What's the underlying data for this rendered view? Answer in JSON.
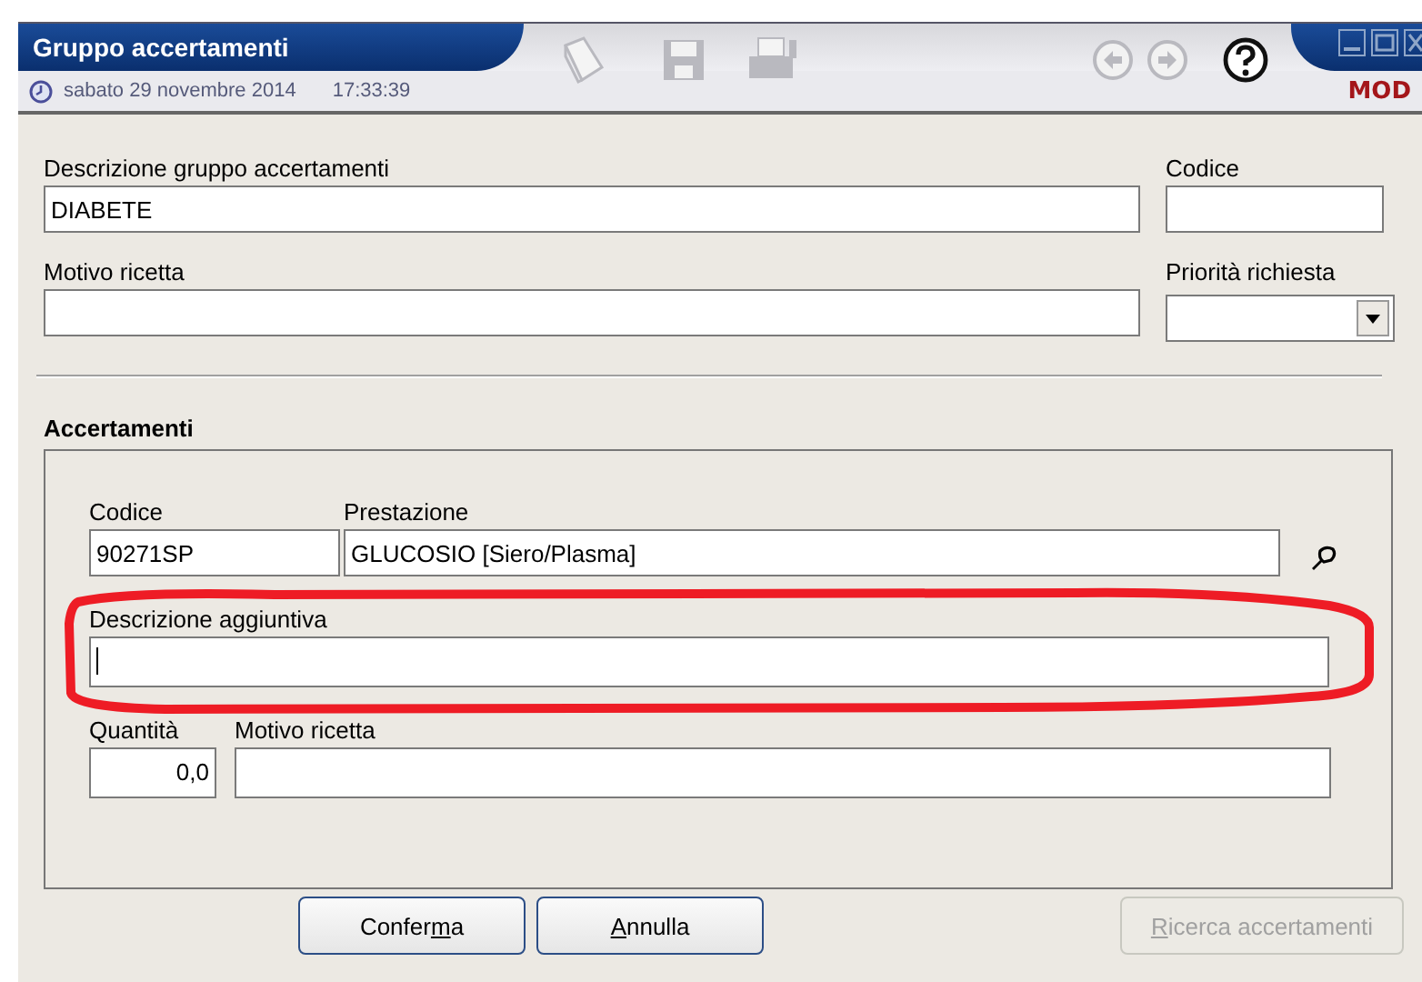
{
  "window": {
    "title": "Gruppo accertamenti",
    "date": "sabato 29 novembre 2014",
    "time": "17:33:39",
    "mode": "MOD"
  },
  "toolbar": [
    {
      "kind": "pages",
      "disabled": true
    },
    {
      "kind": "save",
      "disabled": true
    },
    {
      "kind": "print",
      "disabled": true
    },
    {
      "kind": "back",
      "disabled": true
    },
    {
      "kind": "forward",
      "disabled": true
    },
    {
      "kind": "help",
      "disabled": false
    }
  ],
  "header": {
    "description": {
      "label": "Descrizione gruppo accertamenti",
      "value": "DIABETE"
    },
    "code": {
      "label": "Codice"
    },
    "reason": {
      "label": "Motivo ricetta"
    },
    "priority": {
      "label": "Priorità richiesta"
    }
  },
  "section": {
    "title": "Accertamenti",
    "code": {
      "label": "Codice",
      "value": "90271SP"
    },
    "service": {
      "label": "Prestazione",
      "value": "GLUCOSIO [Siero/Plasma]"
    },
    "extra": {
      "label": "Descrizione aggiuntiva",
      "focused": true,
      "highlighted": true
    },
    "quantity": {
      "label": "Quantità",
      "value": "0,0"
    },
    "reason": {
      "label": "Motivo ricetta"
    }
  },
  "buttons": [
    {
      "before": "Confer",
      "access_key": "m",
      "after": "a",
      "disabled": false
    },
    {
      "access_key": "A",
      "after": "nnulla",
      "disabled": false
    },
    {
      "access_key": "R",
      "after": "icerca accertamenti",
      "disabled": true
    }
  ]
}
